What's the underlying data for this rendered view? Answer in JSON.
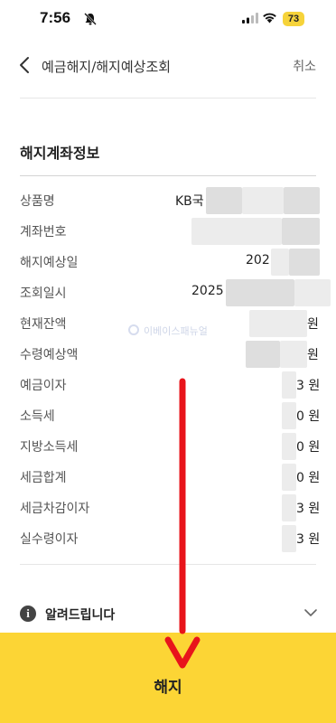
{
  "status_bar": {
    "time": "7:56",
    "battery": "73"
  },
  "header": {
    "title": "예금해지/해지예상조회",
    "cancel_label": "취소"
  },
  "section": {
    "title": "해지계좌정보"
  },
  "rows": [
    {
      "label": "상품명",
      "value": "KB국"
    },
    {
      "label": "계좌번호",
      "value": ""
    },
    {
      "label": "해지예상일",
      "value": "202"
    },
    {
      "label": "조회일시",
      "value": "2025"
    },
    {
      "label": "현재잔액",
      "value": "원"
    },
    {
      "label": "수령예상액",
      "value": "원"
    },
    {
      "label": "예금이자",
      "value": "3 원"
    },
    {
      "label": "소득세",
      "value": "0 원"
    },
    {
      "label": "지방소득세",
      "value": "0 원"
    },
    {
      "label": "세금합계",
      "value": "0 원"
    },
    {
      "label": "세금차감이자",
      "value": "3 원"
    },
    {
      "label": "실수령이자",
      "value": "3 원"
    }
  ],
  "watermark": "이베이스패뉴얼",
  "notice": {
    "label": "알려드립니다"
  },
  "bottom_button": {
    "label": "해지",
    "color": "#fcd535"
  },
  "annotation": {
    "arrow_color": "#e8141b"
  }
}
